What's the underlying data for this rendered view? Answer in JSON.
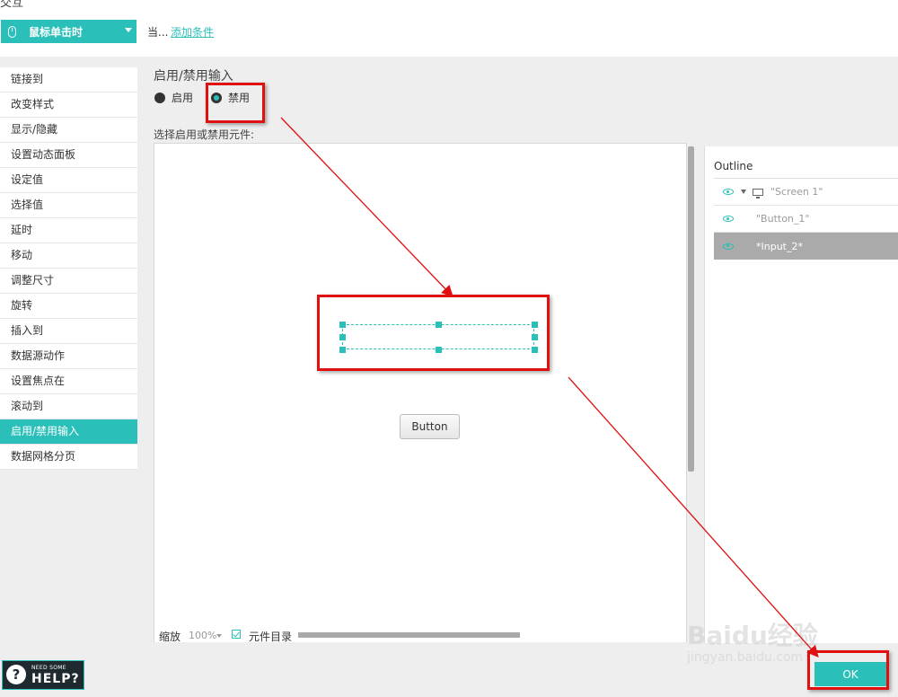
{
  "top": {
    "title": "交互",
    "event_label": "鼠标单击时",
    "when_text": "当...",
    "add_condition": "添加条件"
  },
  "actions": {
    "items": [
      "链接到",
      "改变样式",
      "显示/隐藏",
      "设置动态面板",
      "设定值",
      "选择值",
      "延时",
      "移动",
      "调整尺寸",
      "旋转",
      "插入到",
      "数据源动作",
      "设置焦点在",
      "滚动到",
      "启用/禁用输入",
      "数据网格分页"
    ],
    "active_index": 14
  },
  "options": {
    "heading": "启用/禁用输入",
    "enable_label": "启用",
    "disable_label": "禁用",
    "selected": "禁用",
    "select_label": "选择启用或禁用元件:"
  },
  "canvas": {
    "button_label": "Button",
    "zoom_label": "缩放",
    "zoom_value": "100%",
    "outline_checkbox_label": "元件目录",
    "outline_checked": true
  },
  "outline": {
    "title": "Outline",
    "rows": [
      {
        "label": "\"Screen 1\"",
        "selected": false
      },
      {
        "label": "\"Button_1\"",
        "selected": false
      },
      {
        "label": "*Input_2*",
        "selected": true
      }
    ]
  },
  "footer": {
    "help_small": "NEED SOME",
    "help_big": "HELP?",
    "ok_label": "OK"
  },
  "watermark": {
    "main": "Baidu经验",
    "sub": "jingyan.baidu.com"
  },
  "colors": {
    "accent": "#2bbfb9",
    "annotation": "#e01010",
    "panel_bg": "#eeeeee"
  }
}
